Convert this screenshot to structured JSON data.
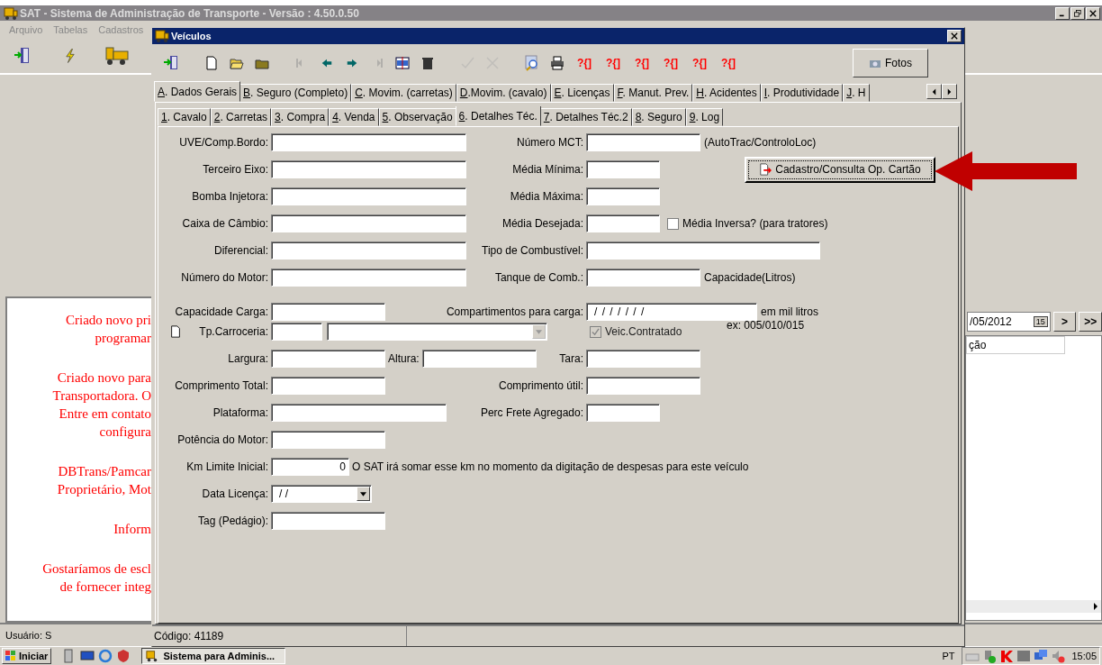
{
  "app": {
    "title": "SAT - Sistema de Administração de Transporte - Versão : 4.50.0.50",
    "menu": [
      "Arquivo",
      "Tabelas",
      "Cadastros"
    ]
  },
  "messages": [
    [
      "Criado novo pri",
      "programar"
    ],
    [
      "Criado novo para",
      "Transportadora. O",
      "Entre em contato",
      "configura"
    ],
    [
      "DBTrans/Pamcar",
      "Proprietário, Mot"
    ],
    [
      "Inform"
    ],
    [
      "Gostaríamos de escl",
      "de fornecer integ"
    ]
  ],
  "right_panel": {
    "date": "/05/2012",
    "calendar": "15",
    "nav_buttons": [
      ">",
      ">>"
    ],
    "list_header": "ção"
  },
  "status_bar": {
    "user": "Usuário: S"
  },
  "window": {
    "title": "Veículos",
    "toolbar": [
      {
        "kind": "exit",
        "disabled": false
      },
      {
        "kind": "new",
        "disabled": false
      },
      {
        "kind": "open",
        "disabled": false
      },
      {
        "kind": "folder",
        "disabled": false
      },
      {
        "kind": "first",
        "disabled": true
      },
      {
        "kind": "prev",
        "disabled": false
      },
      {
        "kind": "next",
        "disabled": false
      },
      {
        "kind": "last",
        "disabled": true
      },
      {
        "kind": "edit",
        "disabled": false
      },
      {
        "kind": "delete",
        "disabled": false
      },
      {
        "kind": "confirm",
        "disabled": true
      },
      {
        "kind": "cancel",
        "disabled": true
      },
      {
        "kind": "search",
        "disabled": false
      },
      {
        "kind": "print",
        "disabled": false
      },
      {
        "kind": "query",
        "label": "?{]"
      },
      {
        "kind": "query",
        "label": "?{]"
      },
      {
        "kind": "query",
        "label": "?{]"
      },
      {
        "kind": "query",
        "label": "?{]"
      },
      {
        "kind": "query",
        "label": "?{]"
      },
      {
        "kind": "query",
        "label": "?{]"
      }
    ],
    "photos_button": "Fotos",
    "tabs": [
      {
        "label": "A. Dados Gerais",
        "selected": true
      },
      {
        "label": "B. Seguro (Completo)",
        "selected": false
      },
      {
        "label": "C. Movim. (carretas)",
        "selected": false
      },
      {
        "label": "D.Movim. (cavalo)",
        "selected": false
      },
      {
        "label": "E. Licenças",
        "selected": false
      },
      {
        "label": "F. Manut. Prev.",
        "selected": false
      },
      {
        "label": "H. Acidentes",
        "selected": false
      },
      {
        "label": "I. Produtividade",
        "selected": false
      },
      {
        "label": "J. H",
        "selected": false
      }
    ],
    "subtabs": [
      {
        "label": "1. Cavalo",
        "selected": false
      },
      {
        "label": "2. Carretas",
        "selected": false
      },
      {
        "label": "3. Compra",
        "selected": false
      },
      {
        "label": "4. Venda",
        "selected": false
      },
      {
        "label": "5. Observação",
        "selected": false
      },
      {
        "label": "6. Detalhes Téc.",
        "selected": true
      },
      {
        "label": "7. Detalhes Téc.2",
        "selected": false
      },
      {
        "label": "8. Seguro",
        "selected": false
      },
      {
        "label": "9. Log",
        "selected": false
      }
    ],
    "status": "Código: 41189"
  },
  "form": {
    "rows": [
      {
        "left": {
          "kind": "text",
          "label": "UVE/Comp.Bordo:"
        },
        "right": {
          "kind": "text",
          "label": "Número MCT:",
          "note": "(AutoTrac/ControloLoc)"
        }
      },
      {
        "left": {
          "kind": "text",
          "label": "Terceiro Eixo:"
        },
        "right": {
          "kind": "text",
          "label": "Média Mínima:",
          "button": "Cadastro/Consulta Op. Cartão"
        }
      },
      {
        "left": {
          "kind": "text",
          "label": "Bomba Injetora:"
        },
        "right": {
          "kind": "text",
          "label": "Média Máxima:"
        }
      },
      {
        "left": {
          "kind": "text",
          "label": "Caixa de Câmbio:"
        },
        "right": {
          "kind": "text",
          "label": "Média Desejada:",
          "checkbox": {
            "label": "Média Inversa? (para tratores)",
            "checked": false,
            "disabled": false
          }
        }
      },
      {
        "left": {
          "kind": "text",
          "label": "Diferencial:"
        },
        "right": {
          "kind": "text",
          "label": "Tipo de Combustível:"
        }
      },
      {
        "left": {
          "kind": "text",
          "label": "Número do Motor:"
        },
        "right": {
          "kind": "text",
          "label": "Tanque de Comb.:",
          "note": "Capacidade(Litros)"
        }
      },
      {
        "left": {
          "kind": "text",
          "label": "Capacidade Carga:"
        },
        "right": {
          "kind": "text",
          "label": "Compartimentos para carga:",
          "value": "/ / / / / / /",
          "note": "em mil litros",
          "hint": "ex: 005/010/015"
        }
      },
      {
        "left": {
          "kind": "body",
          "label": "Tp.Carroceria:"
        },
        "right": {
          "kind": "check",
          "checkbox": {
            "label": "Veic.Contratado",
            "checked": true,
            "disabled": true
          }
        }
      },
      {
        "left": {
          "kind": "pair",
          "label": "Largura:",
          "second_label": "Altura:"
        },
        "right": {
          "kind": "text",
          "label": "Tara:"
        }
      },
      {
        "left": {
          "kind": "text",
          "label": "Comprimento Total:"
        },
        "right": {
          "kind": "text",
          "label": "Comprimento útil:"
        }
      },
      {
        "left": {
          "kind": "text",
          "label": "Plataforma:"
        },
        "right": {
          "kind": "text",
          "label": "Perc Frete Agregado:"
        }
      },
      {
        "left": {
          "kind": "text",
          "label": "Potência do Motor:"
        }
      },
      {
        "left": {
          "kind": "number",
          "label": "Km Limite Inicial:",
          "value": "0",
          "note": "O SAT irá somar esse km no momento da digitação de despesas para este veículo"
        }
      },
      {
        "left": {
          "kind": "date",
          "label": "Data Licença:",
          "value": "/ /"
        }
      },
      {
        "left": {
          "kind": "text",
          "label": "Tag (Pedágio):"
        }
      }
    ]
  },
  "taskbar": {
    "start": "Iniciar",
    "task": "Sistema para Adminis...",
    "language": "PT",
    "clock": "15:05"
  }
}
